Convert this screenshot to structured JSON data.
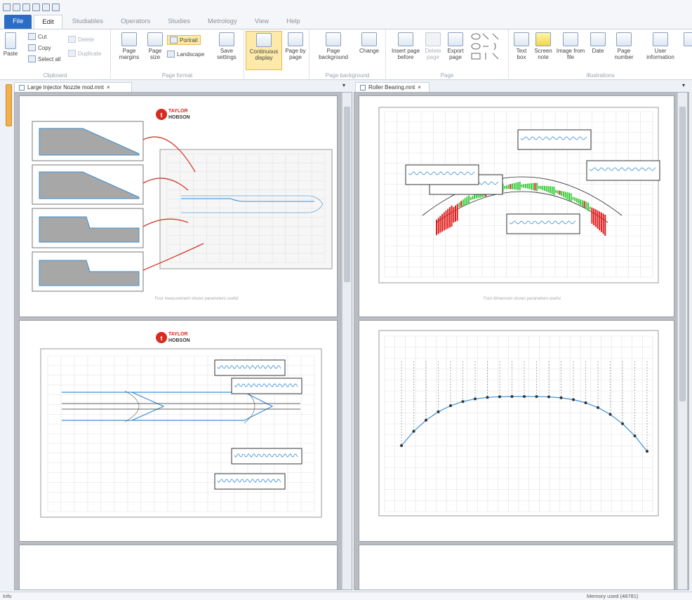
{
  "tabs": [
    {
      "label": "File"
    },
    {
      "label": "Edit"
    },
    {
      "label": "Studiables"
    },
    {
      "label": "Operators"
    },
    {
      "label": "Studies"
    },
    {
      "label": "Metrology"
    },
    {
      "label": "View"
    },
    {
      "label": "Help"
    }
  ],
  "ribbon": {
    "clipboard": {
      "label": "Clipboard",
      "paste": "Paste",
      "cut": "Cut",
      "copy": "Copy",
      "select_all": "Select all",
      "delete": "Delete",
      "duplicate": "Duplicate"
    },
    "page_format": {
      "label": "Page format",
      "page_margins": "Page margins",
      "page_size": "Page size",
      "portrait": "Portrait",
      "landscape": "Landscape",
      "save_settings": "Save settings"
    },
    "continuous_display": "Continuous display",
    "page_by_page": "Page by page",
    "page_background_group": {
      "label": "Page background",
      "page_background": "Page background",
      "change": "Change"
    },
    "page": {
      "label": "Page",
      "insert_page_before": "Insert page before",
      "delete_page": "Delete page",
      "export_page": "Export page"
    },
    "illustrations": {
      "label": "Illustrations",
      "text_box": "Text box",
      "screen_note": "Screen note",
      "image_from_file": "Image from file",
      "date": "Date",
      "page_number": "Page number",
      "user_information": "User information"
    }
  },
  "documents": {
    "left_tab": "Large Injector Nozzle mod.mnt",
    "right_tab": "Roller Bearing.mnt"
  },
  "pages": {
    "logo_text_1": "TAYLOR",
    "logo_text_2": "HOBSON",
    "caption_left": "Four measurement shows parameters useful",
    "caption_right": "Four dimension shows parameters useful"
  },
  "status": {
    "left": "Info",
    "right": "Memory used (48781)"
  },
  "colors": {
    "accent": "#2b6cc4",
    "plot_line": "#3a8fd6",
    "red_marks": "#e02020",
    "green_marks": "#3fce3f",
    "arrow": "#d23a2a"
  }
}
